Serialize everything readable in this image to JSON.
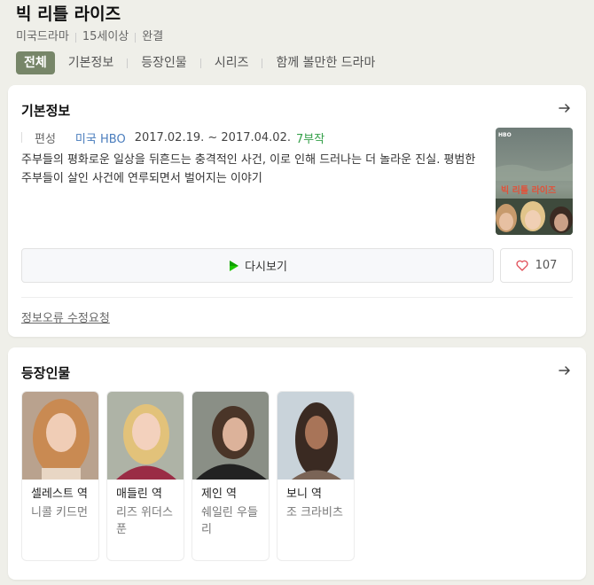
{
  "show": {
    "title": "빅 리틀 라이즈",
    "meta": [
      "미국드라마",
      "15세이상",
      "완결"
    ]
  },
  "tabs": [
    "전체",
    "기본정보",
    "등장인물",
    "시리즈",
    "함께 볼만한 드라마"
  ],
  "basic_info": {
    "heading": "기본정보",
    "label": "편성",
    "broadcaster": "미국 HBO",
    "date_range": "2017.02.19. ~ 2017.04.02.",
    "episodes": "7부작",
    "synopsis": "주부들의 평화로운 일상을 뒤흔드는 충격적인 사건, 이로 인해 드러나는 더 놀라운 진실. 평범한 주부들이 살인 사건에 연루되면서 벌어지는 이야기",
    "poster": {
      "badge": "HBO",
      "title": "빅 리틀 라이즈"
    },
    "replay_label": "다시보기",
    "like_count": "107",
    "report_link": "정보오류 수정요청"
  },
  "cast": {
    "heading": "등장인물",
    "members": [
      {
        "role": "셀레스트 역",
        "actor": "니콜 키드먼"
      },
      {
        "role": "매들린 역",
        "actor": "리즈 위더스푼"
      },
      {
        "role": "제인 역",
        "actor": "쉐일린 우들리"
      },
      {
        "role": "보니 역",
        "actor": "조 크라비츠"
      }
    ]
  },
  "colors": {
    "active_tab": "#778669",
    "broadcaster": "#4a7dbd",
    "episodes": "#35a04a",
    "background": "#efefe9"
  },
  "icons": [
    "arrow-right-icon",
    "play-icon",
    "heart-icon"
  ]
}
